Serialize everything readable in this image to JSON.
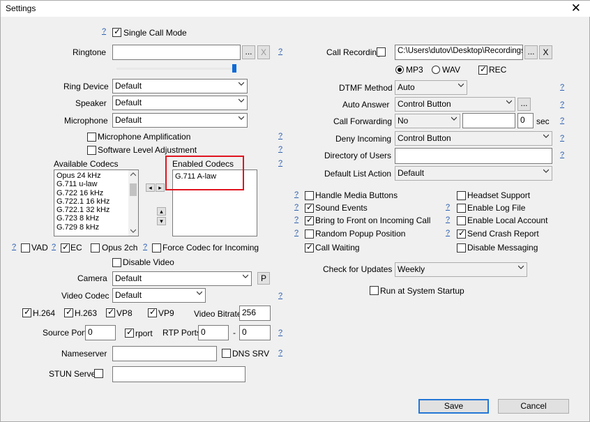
{
  "window": {
    "title": "Settings",
    "close_glyph": "✕"
  },
  "help_glyph": "?",
  "left": {
    "single_call_mode": {
      "label": "Single Call Mode",
      "checked": true
    },
    "ringtone": {
      "label": "Ringtone",
      "value": "",
      "browse": "...",
      "clear": "X"
    },
    "ring_device": {
      "label": "Ring Device",
      "value": "Default"
    },
    "speaker": {
      "label": "Speaker",
      "value": "Default"
    },
    "microphone": {
      "label": "Microphone",
      "value": "Default"
    },
    "mic_amplification": {
      "label": "Microphone Amplification",
      "checked": false
    },
    "software_level": {
      "label": "Software Level Adjustment",
      "checked": false
    },
    "available_codecs": {
      "label": "Available Codecs",
      "items": [
        "Opus 24 kHz",
        "G.711 u-law",
        "G.722 16 kHz",
        "G.722.1 16 kHz",
        "G.722.1 32 kHz",
        "G.723 8 kHz",
        "G.729 8 kHz"
      ]
    },
    "enabled_codecs": {
      "label": "Enabled Codecs",
      "items": [
        "G.711 A-law"
      ]
    },
    "move_left": "◂",
    "move_right": "▸",
    "move_up": "▴",
    "move_down": "▾",
    "vad": {
      "label": "VAD",
      "checked": false
    },
    "ec": {
      "label": "EC",
      "checked": true
    },
    "opus_2ch": {
      "label": "Opus 2ch",
      "checked": false
    },
    "force_codec": {
      "label": "Force Codec for Incoming",
      "checked": false
    },
    "disable_video": {
      "label": "Disable Video",
      "checked": false
    },
    "camera": {
      "label": "Camera",
      "value": "Default",
      "p_button": "P"
    },
    "video_codec": {
      "label": "Video Codec",
      "value": "Default"
    },
    "h264": {
      "label": "H.264",
      "checked": true
    },
    "h263": {
      "label": "H.263",
      "checked": true
    },
    "vp8": {
      "label": "VP8",
      "checked": true
    },
    "vp9": {
      "label": "VP9",
      "checked": true
    },
    "video_bitrate": {
      "label": "Video Bitrate",
      "value": "256"
    },
    "source_port": {
      "label": "Source Port",
      "value": "0"
    },
    "rport": {
      "label": "rport",
      "checked": true
    },
    "rtp_ports": {
      "label": "RTP Ports",
      "from": "0",
      "dash": "-",
      "to": "0"
    },
    "nameserver": {
      "label": "Nameserver",
      "value": ""
    },
    "dns_srv": {
      "label": "DNS SRV",
      "checked": false
    },
    "stun_server": {
      "label": "STUN Server",
      "checked": false,
      "value": ""
    }
  },
  "right": {
    "call_recording": {
      "label": "Call Recording",
      "checked": false,
      "path": "C:\\Users\\dutov\\Desktop\\Recordings",
      "browse": "...",
      "clear": "X"
    },
    "format": {
      "mp3": "MP3",
      "wav": "WAV",
      "selected": "MP3",
      "rec": {
        "label": "REC",
        "checked": true
      }
    },
    "dtmf_method": {
      "label": "DTMF Method",
      "value": "Auto"
    },
    "auto_answer": {
      "label": "Auto Answer",
      "value": "Control Button",
      "extra": "..."
    },
    "call_forwarding": {
      "label": "Call Forwarding",
      "value": "No",
      "target": "",
      "seconds": "0",
      "unit": "sec"
    },
    "deny_incoming": {
      "label": "Deny Incoming",
      "value": "Control Button"
    },
    "directory_of_users": {
      "label": "Directory of Users",
      "value": ""
    },
    "default_list_action": {
      "label": "Default List Action",
      "value": "Default"
    },
    "checks_left": [
      {
        "label": "Handle Media Buttons",
        "checked": false
      },
      {
        "label": "Sound Events",
        "checked": true
      },
      {
        "label": "Bring to Front on Incoming Call",
        "checked": true
      },
      {
        "label": "Random Popup Position",
        "checked": false
      },
      {
        "label": "Call Waiting",
        "checked": true
      }
    ],
    "checks_right": [
      {
        "label": "Headset Support",
        "checked": false
      },
      {
        "label": "Enable Log File",
        "checked": false
      },
      {
        "label": "Enable Local Account",
        "checked": false
      },
      {
        "label": "Send Crash Report",
        "checked": true
      },
      {
        "label": "Disable Messaging",
        "checked": false
      }
    ],
    "check_for_updates": {
      "label": "Check for Updates",
      "value": "Weekly"
    },
    "run_at_startup": {
      "label": "Run at System Startup",
      "checked": false
    }
  },
  "footer": {
    "save": "Save",
    "cancel": "Cancel"
  },
  "colors": {
    "help_link": "#2a5db0",
    "highlight_box": "#e0141f",
    "primary_border": "#2477d6",
    "slider_thumb": "#0d6ad6"
  }
}
